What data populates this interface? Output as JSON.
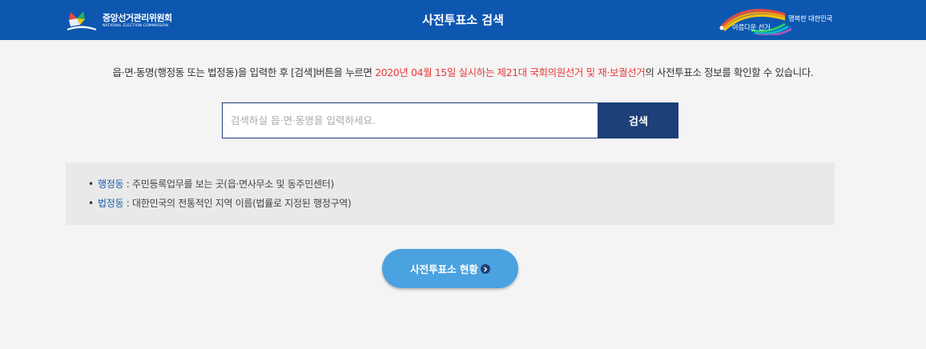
{
  "header": {
    "title": "사전투표소 검색",
    "logo_left_ko": "중앙선거관리위원회",
    "logo_left_en": "NATIONAL ELECTION COMMISSION",
    "logo_right_line1": "행복한 대한민국",
    "logo_right_line2": "아름다운 선거",
    "color": "#0d57b1"
  },
  "intro": {
    "before": "읍·면·동명(행정동 또는 법정동)을 입력한 후 [검색]버튼을 누르면 ",
    "highlight": "2020년 04월 15일 실시하는 제21대 국회의원선거 및 재·보궐선거",
    "after": "의 사전투표소 정보를 확인할 수 있습니다.",
    "highlight_color": "#e63b3b"
  },
  "search": {
    "placeholder": "검색하실 읍·면·동명을 입력하세요.",
    "value": "",
    "button_label": "검색"
  },
  "info": {
    "items": [
      {
        "term": "행정동",
        "description": " : 주민등록업무를 보는 곳(읍·면사무소 및 동주민센터)"
      },
      {
        "term": "법정동",
        "description": " : 대한민국의 전통적인 지역 이름(법률로 지정된 행정구역)"
      }
    ]
  },
  "status_button": {
    "label": "사전투표소 현황"
  },
  "icons": {
    "logo": "nec-logo-icon",
    "right_logo": "rainbow-logo-icon",
    "arrow": "chevron-right-circle-icon"
  }
}
